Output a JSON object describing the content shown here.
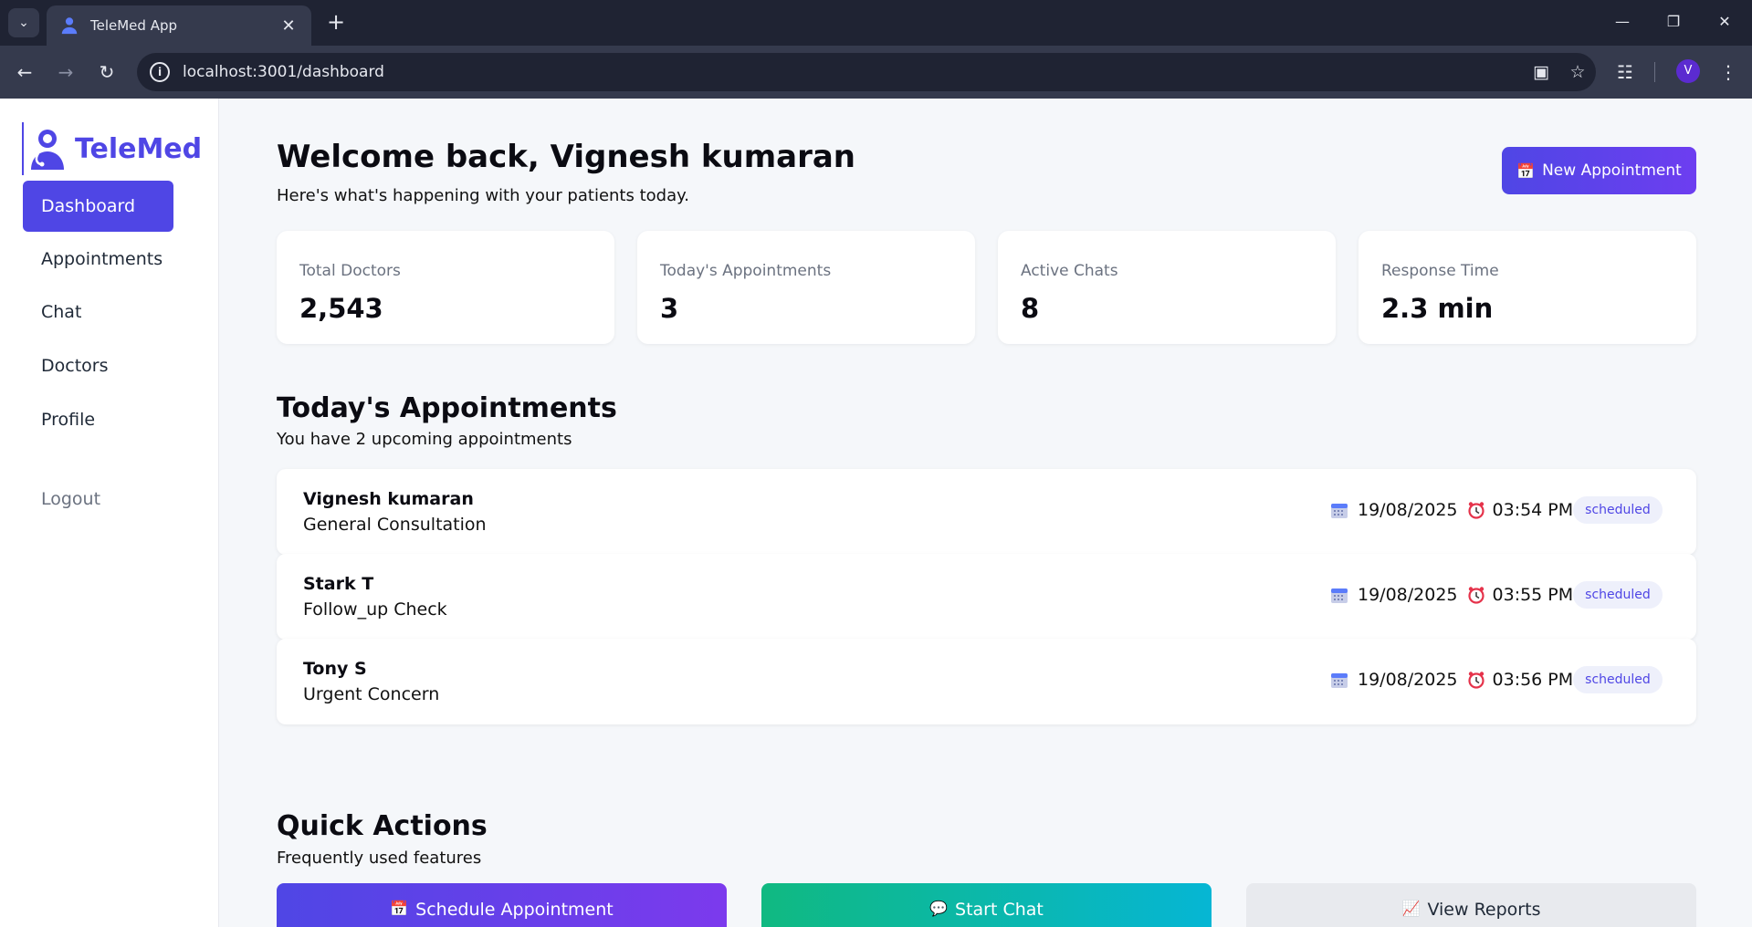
{
  "browser": {
    "tab_title": "TeleMed App",
    "url": "localhost:3001/dashboard",
    "profile_initial": "V"
  },
  "sidebar": {
    "brand": "TeleMed",
    "items": [
      {
        "label": "Dashboard",
        "active": true
      },
      {
        "label": "Appointments",
        "active": false
      },
      {
        "label": "Chat",
        "active": false
      },
      {
        "label": "Doctors",
        "active": false
      },
      {
        "label": "Profile",
        "active": false
      }
    ],
    "logout": "Logout"
  },
  "header": {
    "title": "Welcome back, Vignesh kumaran",
    "subtitle": "Here's what's happening with your patients today.",
    "new_appointment": "New Appointment"
  },
  "stats": [
    {
      "label": "Total Doctors",
      "value": "2,543"
    },
    {
      "label": "Today's Appointments",
      "value": "3"
    },
    {
      "label": "Active Chats",
      "value": "8"
    },
    {
      "label": "Response Time",
      "value": "2.3 min"
    }
  ],
  "appointments": {
    "title": "Today's Appointments",
    "subtitle": "You have 2 upcoming appointments",
    "items": [
      {
        "name": "Vignesh kumaran",
        "type": "General Consultation",
        "date": "19/08/2025",
        "time": "03:54 PM",
        "status": "scheduled"
      },
      {
        "name": "Stark T",
        "type": "Follow_up Check",
        "date": "19/08/2025",
        "time": "03:55 PM",
        "status": "scheduled"
      },
      {
        "name": "Tony S",
        "type": "Urgent Concern",
        "date": "19/08/2025",
        "time": "03:56 PM",
        "status": "scheduled"
      }
    ]
  },
  "quick_actions": {
    "title": "Quick Actions",
    "subtitle": "Frequently used features",
    "buttons": [
      {
        "label": "Schedule Appointment",
        "icon": "calendar-icon"
      },
      {
        "label": "Start Chat",
        "icon": "chat-bubble-icon"
      },
      {
        "label": "View Reports",
        "icon": "chart-icon"
      }
    ]
  },
  "colors": {
    "accent": "#4f46e5",
    "chat_gradient_start": "#10b981",
    "chat_gradient_end": "#06b6d4"
  }
}
